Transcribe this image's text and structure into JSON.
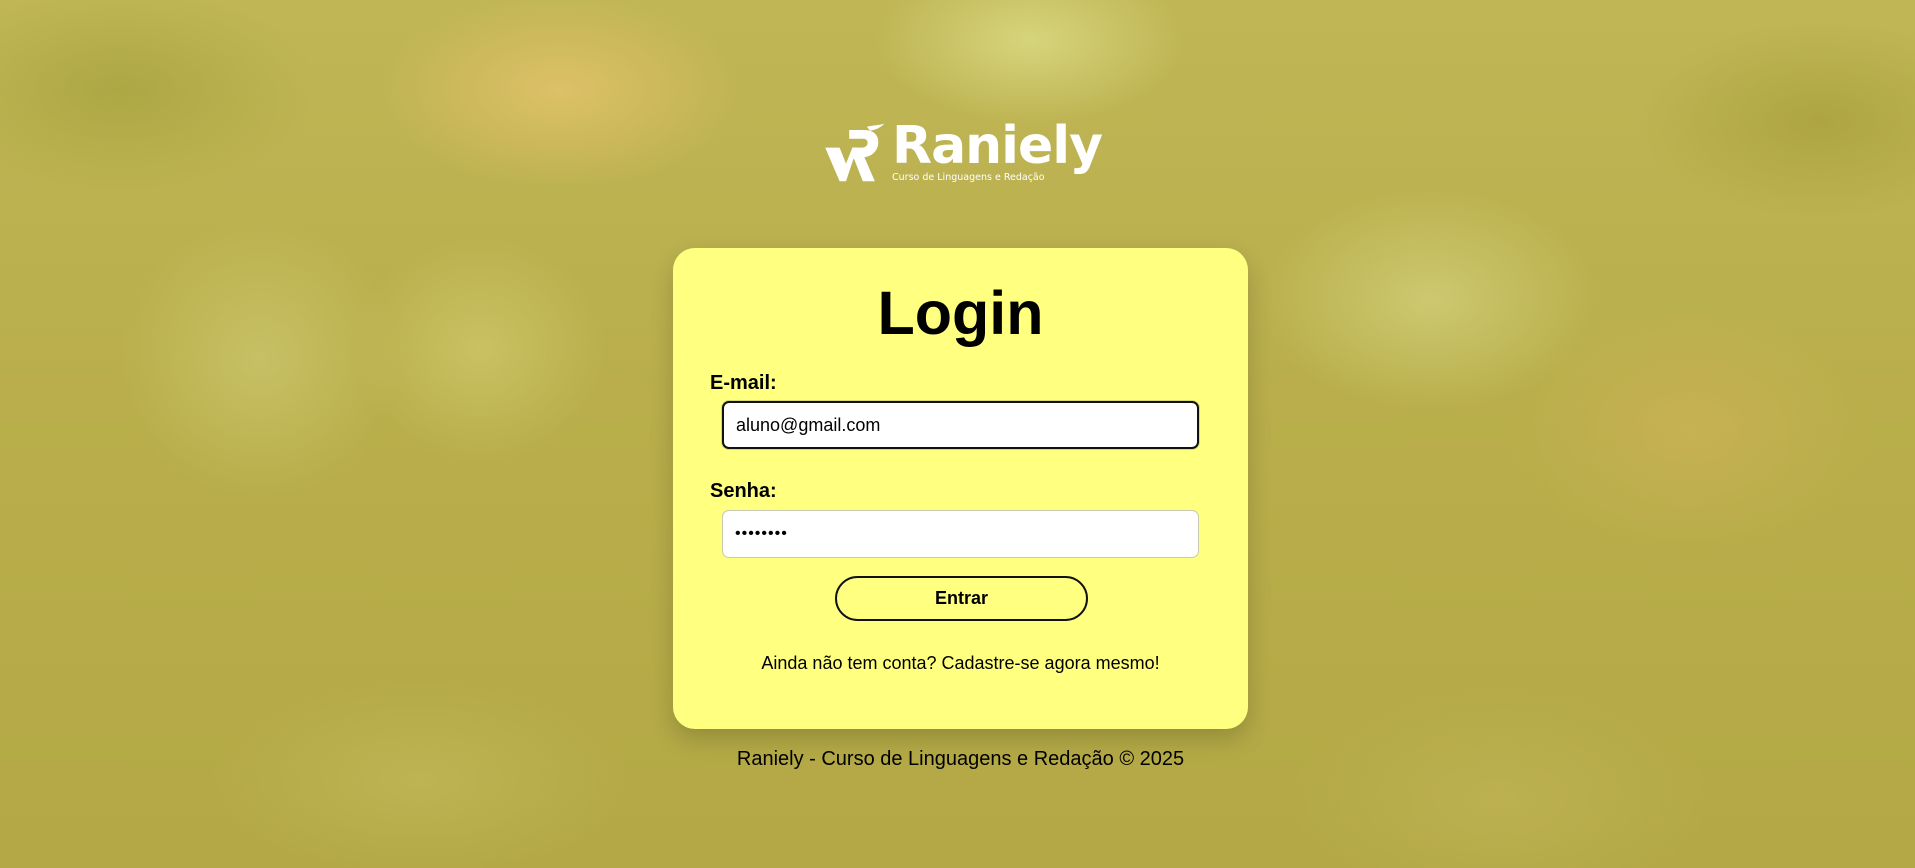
{
  "brand": {
    "name": "Raniely",
    "tagline": "Curso de Linguagens e Redação"
  },
  "login": {
    "title": "Login",
    "email_label": "E-mail:",
    "email_value": "aluno@gmail.com",
    "password_label": "Senha:",
    "password_masked": "••••••••",
    "submit_label": "Entrar",
    "signup_text": "Ainda não tem conta? Cadastre-se agora mesmo!"
  },
  "footer": {
    "text": "Raniely - Curso de Linguagens e Redação © 2025"
  },
  "colors": {
    "card_background": "#ffff80",
    "page_background": "#b7ad48",
    "logo": "#ffffff",
    "text": "#000000"
  }
}
